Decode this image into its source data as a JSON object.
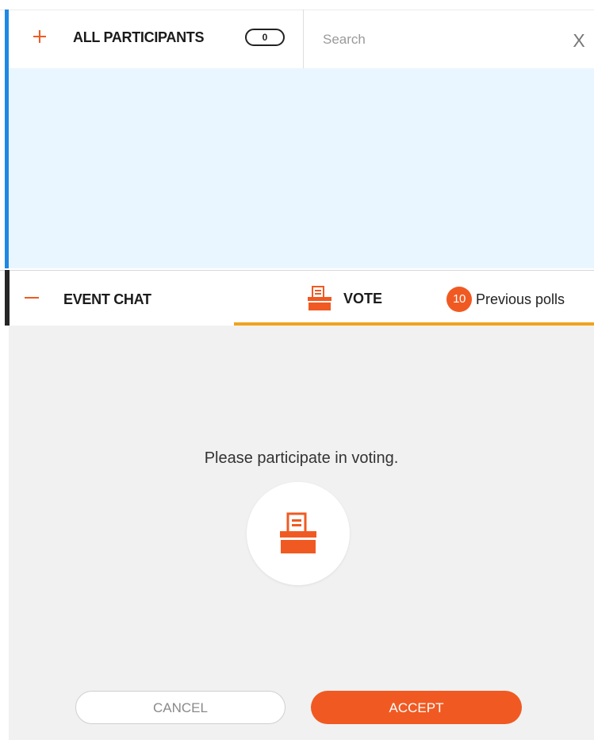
{
  "participants": {
    "title": "ALL PARTICIPANTS",
    "count": "0",
    "search_placeholder": "Search",
    "close_label": "X"
  },
  "chat": {
    "title": "EVENT CHAT",
    "vote_tab_label": "VOTE",
    "previous_polls_count": "10",
    "previous_polls_label": "Previous polls"
  },
  "vote": {
    "prompt": "Please participate in voting.",
    "cancel_label": "CANCEL",
    "accept_label": "ACCEPT"
  },
  "colors": {
    "accent_orange": "#f05a22",
    "accent_blue": "#1e88e5",
    "tab_underline": "#f0a31e",
    "participants_bg": "#eaf6ff",
    "panel_bg": "#f1f1f1"
  },
  "icons": {
    "expand": "plus-icon",
    "collapse": "minus-icon",
    "vote": "ballot-box-icon",
    "close": "close-icon"
  }
}
